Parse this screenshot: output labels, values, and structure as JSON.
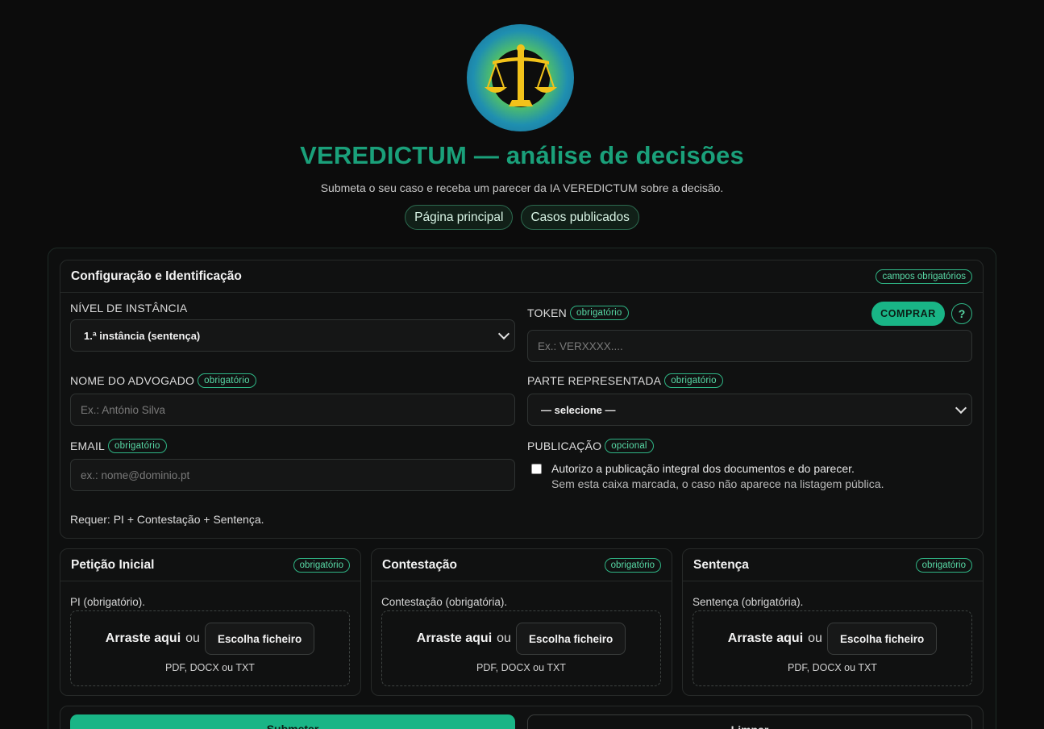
{
  "header": {
    "title": "VEREDICTUM — análise de decisões",
    "subtitle": "Submeta o seu caso e receba um parecer da IA VEREDICTUM sobre a decisão.",
    "nav": [
      "Página principal",
      "Casos publicados"
    ],
    "logo_icon": "scales-of-justice-icon"
  },
  "config": {
    "title": "Configuração e Identificação",
    "badge": "campos obrigatórios",
    "instance": {
      "label": "NÍVEL DE INSTÂNCIA",
      "value": "1.ª instância (sentença)"
    },
    "token": {
      "label": "TOKEN",
      "badge": "obrigatório",
      "placeholder": "Ex.: VERXXXX....",
      "buy": "COMPRAR",
      "help": "?"
    },
    "lawyer": {
      "label": "NOME DO ADVOGADO",
      "badge": "obrigatório",
      "placeholder": "Ex.: António Silva"
    },
    "party": {
      "label": "PARTE REPRESENTADA",
      "badge": "obrigatório",
      "value": "— selecione —"
    },
    "email": {
      "label": "EMAIL",
      "badge": "obrigatório",
      "placeholder": "ex.: nome@dominio.pt"
    },
    "publication": {
      "label": "PUBLICAÇÃO",
      "badge": "opcional",
      "checked": false,
      "text1": "Autorizo a publicação integral dos documentos e do parecer.",
      "text2": "Sem esta caixa marcada, o caso não aparece na listagem pública."
    },
    "requires": "Requer: PI + Contestação + Sentença."
  },
  "documents": [
    {
      "title": "Petição Inicial",
      "badge": "obrigatório",
      "desc": "PI (obrigatório).",
      "drag": "Arraste aqui",
      "or": "ou",
      "choose": "Escolha ficheiro",
      "formats": "PDF, DOCX ou TXT"
    },
    {
      "title": "Contestação",
      "badge": "obrigatório",
      "desc": "Contestação (obrigatória).",
      "drag": "Arraste aqui",
      "or": "ou",
      "choose": "Escolha ficheiro",
      "formats": "PDF, DOCX ou TXT"
    },
    {
      "title": "Sentença",
      "badge": "obrigatório",
      "desc": "Sentença (obrigatória).",
      "drag": "Arraste aqui",
      "or": "ou",
      "choose": "Escolha ficheiro",
      "formats": "PDF, DOCX ou TXT"
    }
  ],
  "actions": {
    "submit": "Submeter",
    "clear": "Limpar"
  },
  "colors": {
    "accent": "#19b586",
    "title": "#1aa07a",
    "background": "#0c0c0c"
  }
}
